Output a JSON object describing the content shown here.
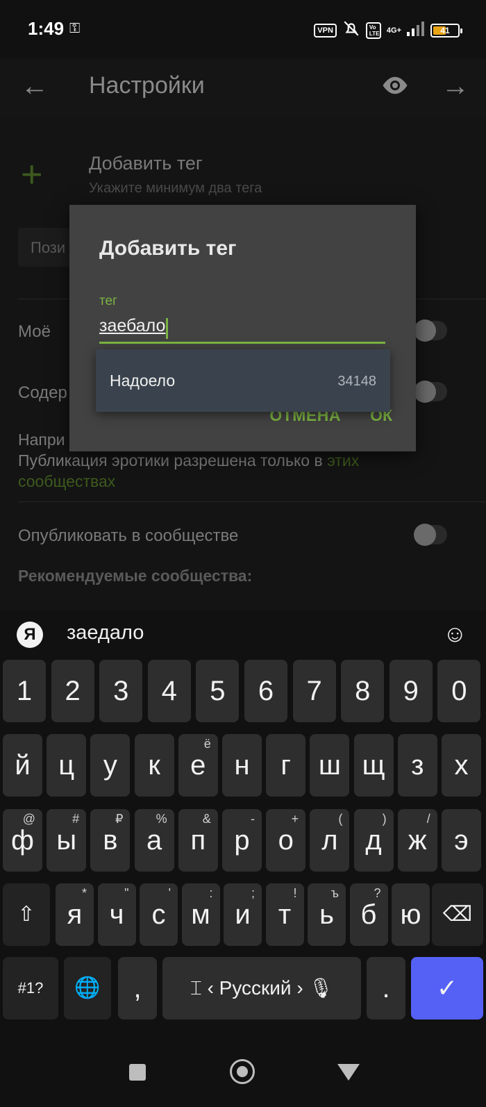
{
  "status_bar": {
    "time": "1:49",
    "key_icon": "key-icon",
    "vpn": "VPN",
    "volte": "Vo LTE",
    "network": "4G+",
    "battery": "41"
  },
  "app_bar": {
    "title": "Настройки"
  },
  "settings": {
    "add_tag_title": "Добавить тег",
    "add_tag_subtitle": "Укажите минимум два тега",
    "position_placeholder": "Пози",
    "my_label": "Моё",
    "content_label": "Содер",
    "note_prefix": "Напри",
    "note_line": "Публикация эротики разрешена только в",
    "note_link_part1": "этих",
    "note_link_part2": "сообществах",
    "publish_label": "Опубликовать в сообществе",
    "recommended_label": "Рекомендуемые сообщества:"
  },
  "dialog": {
    "title": "Добавить тег",
    "field_label": "тег",
    "field_value": "заебало",
    "cancel_label": "ОТМЕНА",
    "ok_label": "ОК"
  },
  "suggestion": {
    "text": "Надоело",
    "count": "34148"
  },
  "keyboard": {
    "suggestion": "заедало",
    "row_numbers": [
      "1",
      "2",
      "3",
      "4",
      "5",
      "6",
      "7",
      "8",
      "9",
      "0"
    ],
    "row1": [
      {
        "k": "й",
        "a": ""
      },
      {
        "k": "ц",
        "a": ""
      },
      {
        "k": "у",
        "a": ""
      },
      {
        "k": "к",
        "a": ""
      },
      {
        "k": "е",
        "a": "ё"
      },
      {
        "k": "н",
        "a": ""
      },
      {
        "k": "г",
        "a": ""
      },
      {
        "k": "ш",
        "a": ""
      },
      {
        "k": "щ",
        "a": ""
      },
      {
        "k": "з",
        "a": ""
      },
      {
        "k": "х",
        "a": ""
      }
    ],
    "row2": [
      {
        "k": "ф",
        "a": "@"
      },
      {
        "k": "ы",
        "a": "#"
      },
      {
        "k": "в",
        "a": "₽"
      },
      {
        "k": "а",
        "a": "%"
      },
      {
        "k": "п",
        "a": "&"
      },
      {
        "k": "р",
        "a": "-"
      },
      {
        "k": "о",
        "a": "+"
      },
      {
        "k": "л",
        "a": "("
      },
      {
        "k": "д",
        "a": ")"
      },
      {
        "k": "ж",
        "a": "/"
      },
      {
        "k": "э",
        "a": ""
      }
    ],
    "row3": [
      {
        "k": "я",
        "a": "*"
      },
      {
        "k": "ч",
        "a": "\""
      },
      {
        "k": "с",
        "a": "'"
      },
      {
        "k": "м",
        "a": ":"
      },
      {
        "k": "и",
        "a": ";"
      },
      {
        "k": "т",
        "a": "!"
      },
      {
        "k": "ь",
        "a": "ъ"
      },
      {
        "k": "б",
        "a": "?"
      },
      {
        "k": "ю",
        "a": ""
      }
    ],
    "symbols_label": "#1?",
    "comma_label": ",",
    "space_label": "Русский",
    "period_label": ".",
    "enter_icon": "check-icon"
  }
}
